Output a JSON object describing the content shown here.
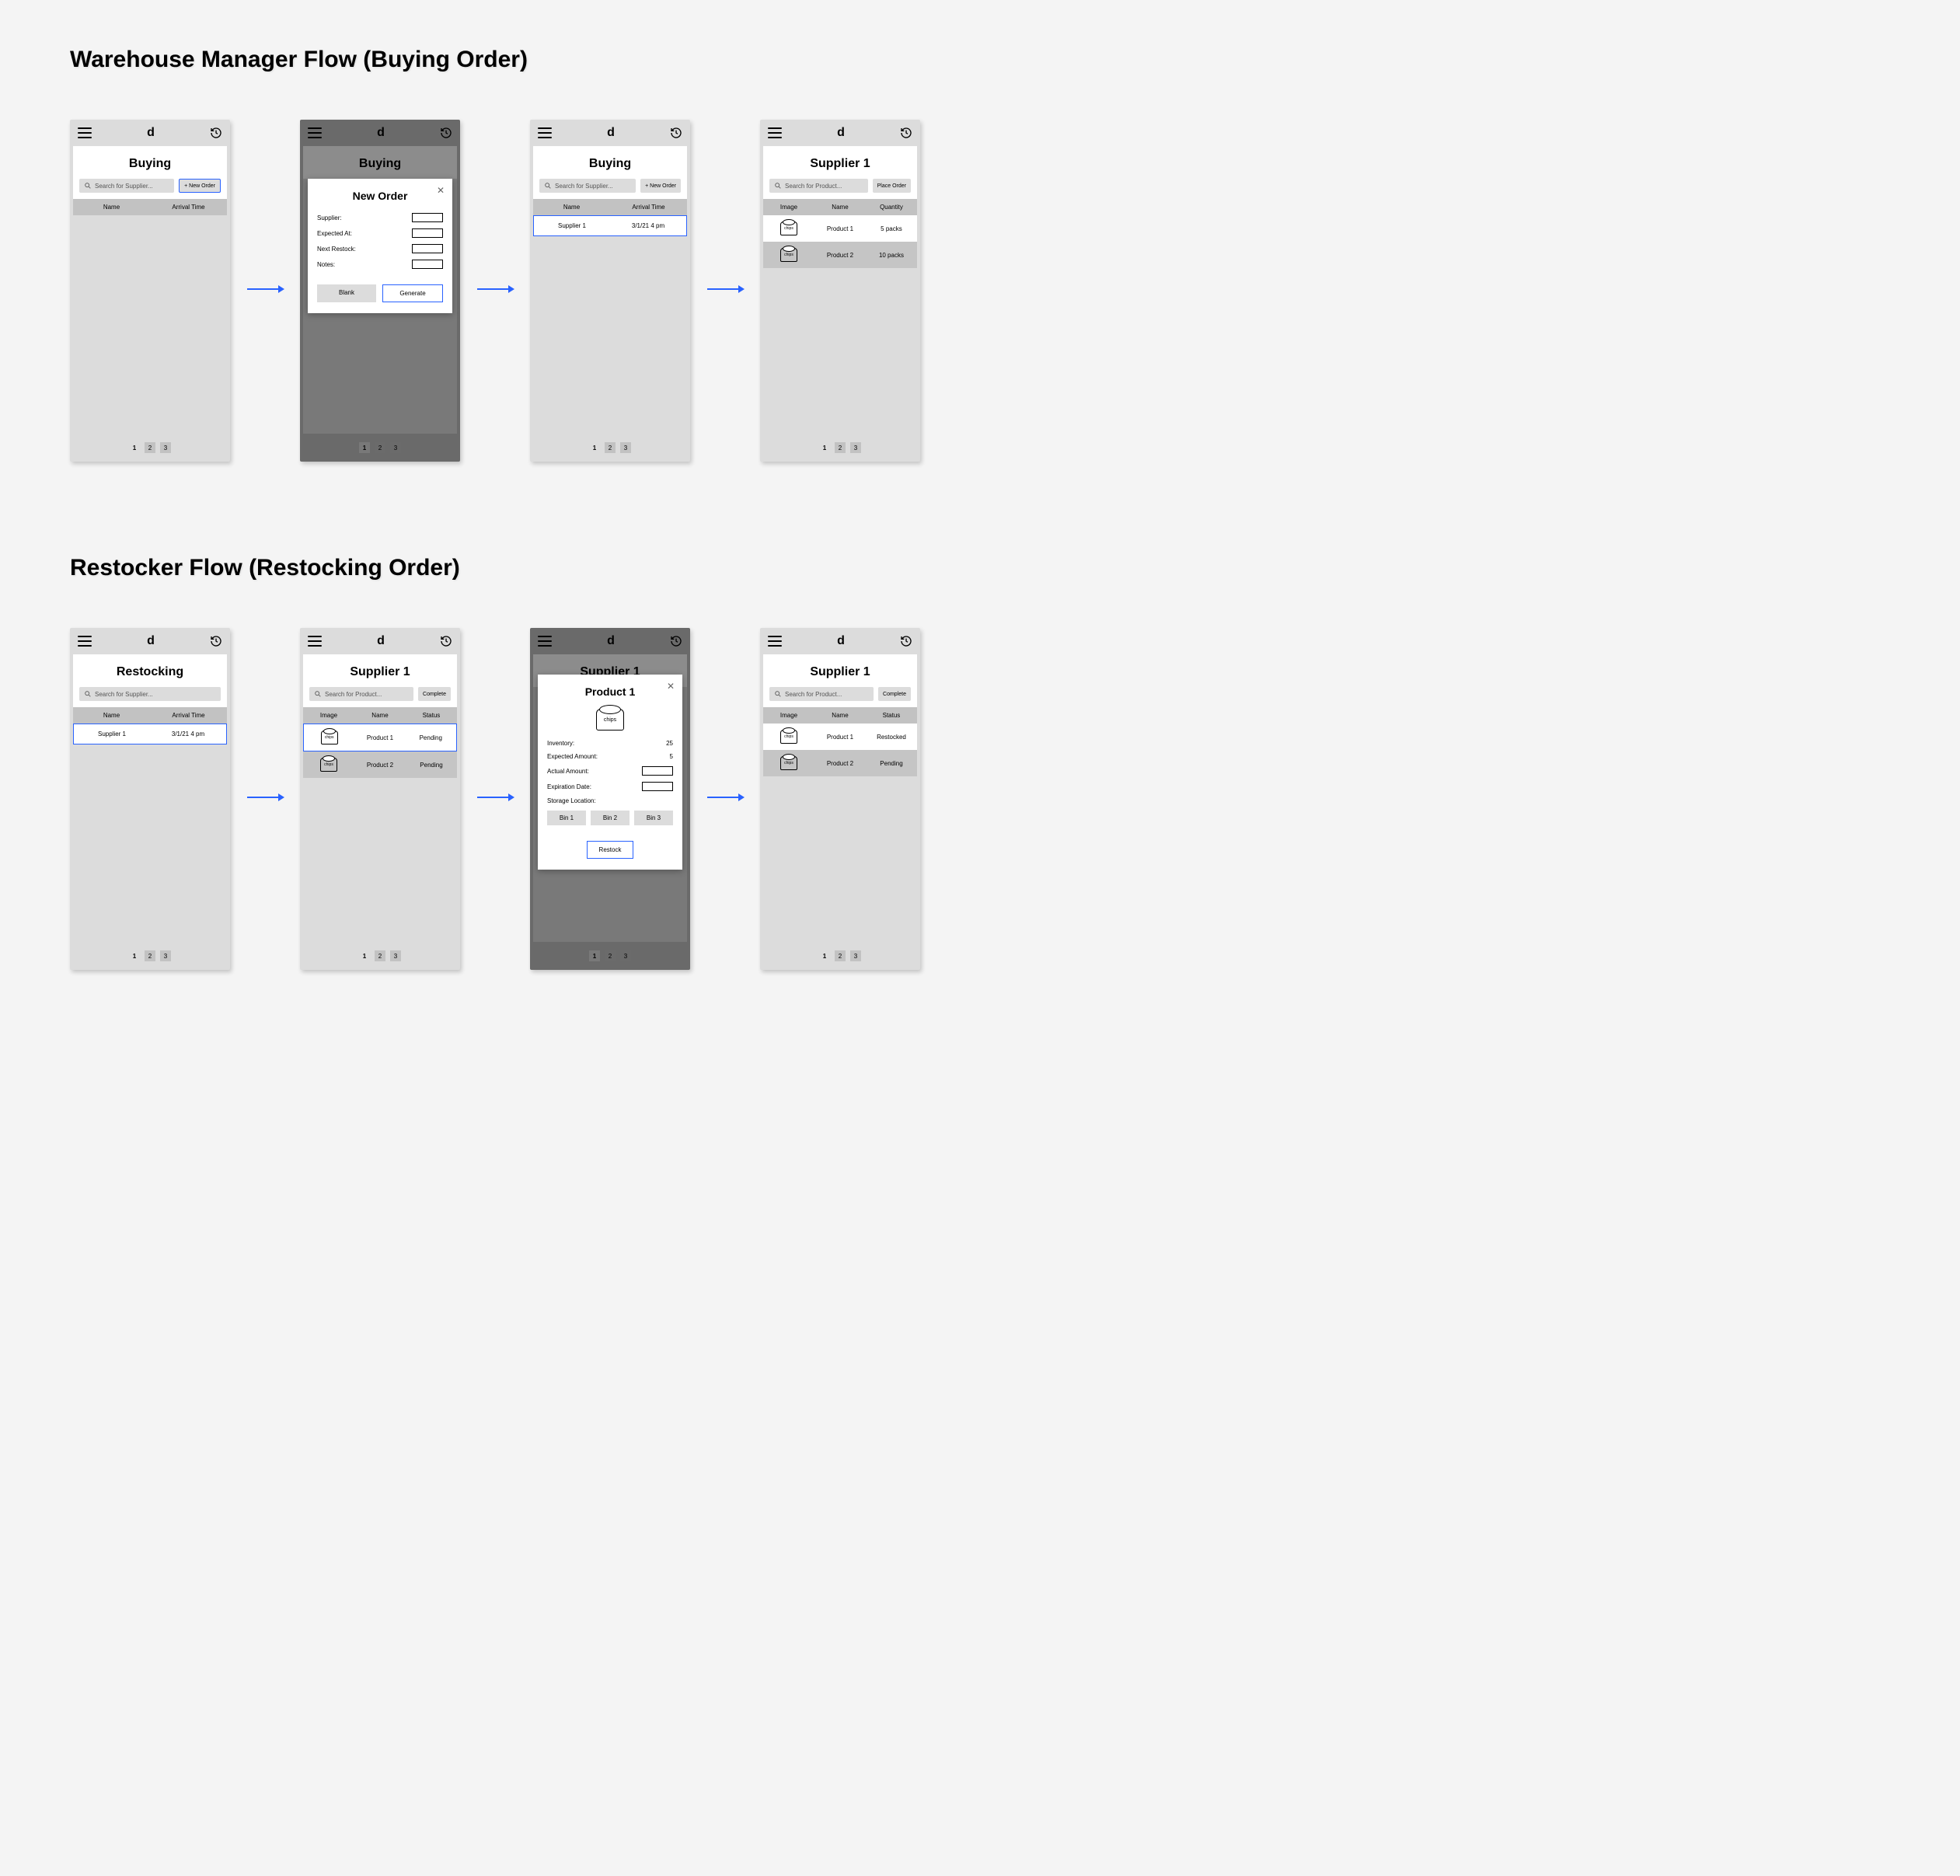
{
  "flow1": {
    "title": "Warehouse Manager Flow (Buying Order)",
    "screens": {
      "s1": {
        "title": "Buying",
        "search_placeholder": "Search for Supplier...",
        "action": "+ New Order",
        "cols": [
          "Name",
          "Arrival Time"
        ]
      },
      "s2": {
        "title": "Buying",
        "modal": {
          "title": "New Order",
          "fields": [
            "Supplier:",
            "Expected At:",
            "Next Restock:",
            "Notes:"
          ],
          "btn1": "Blank",
          "btn2": "Generate"
        }
      },
      "s3": {
        "title": "Buying",
        "search_placeholder": "Search for Supplier...",
        "action": "+ New Order",
        "cols": [
          "Name",
          "Arrival Time"
        ],
        "rows": [
          {
            "name": "Supplier 1",
            "time": "3/1/21  4 pm"
          }
        ]
      },
      "s4": {
        "title": "Supplier 1",
        "search_placeholder": "Search for Product...",
        "action": "Place Order",
        "cols": [
          "Image",
          "Name",
          "Quantity"
        ],
        "rows": [
          {
            "img": "chips",
            "name": "Product 1",
            "qty": "5 packs"
          },
          {
            "img": "chips",
            "name": "Product 2",
            "qty": "10 packs"
          }
        ]
      }
    }
  },
  "flow2": {
    "title": "Restocker Flow (Restocking Order)",
    "screens": {
      "s1": {
        "title": "Restocking",
        "search_placeholder": "Search for Supplier...",
        "cols": [
          "Name",
          "Arrival Time"
        ],
        "rows": [
          {
            "name": "Supplier 1",
            "time": "3/1/21  4 pm"
          }
        ]
      },
      "s2": {
        "title": "Supplier 1",
        "search_placeholder": "Search for Product...",
        "action": "Complete",
        "cols": [
          "Image",
          "Name",
          "Status"
        ],
        "rows": [
          {
            "img": "chips",
            "name": "Product 1",
            "status": "Pending"
          },
          {
            "img": "chips",
            "name": "Product 2",
            "status": "Pending"
          }
        ]
      },
      "s3": {
        "title": "Supplier 1",
        "modal": {
          "title": "Product 1",
          "img": "chips",
          "inventory_label": "Inventory:",
          "inventory_val": "25",
          "expected_label": "Expected Amount:",
          "expected_val": "5",
          "actual_label": "Actual Amount:",
          "expiration_label": "Expiration Date:",
          "storage_label": "Storage Location:",
          "bins": [
            "Bin 1",
            "Bin 2",
            "Bin 3"
          ],
          "btn": "Restock"
        }
      },
      "s4": {
        "title": "Supplier 1",
        "search_placeholder": "Search for Product...",
        "action": "Complete",
        "cols": [
          "Image",
          "Name",
          "Status"
        ],
        "rows": [
          {
            "img": "chips",
            "name": "Product 1",
            "status": "Restocked"
          },
          {
            "img": "chips",
            "name": "Product 2",
            "status": "Pending"
          }
        ]
      }
    }
  },
  "common": {
    "logo": "d",
    "pages": [
      "1",
      "2",
      "3"
    ]
  }
}
